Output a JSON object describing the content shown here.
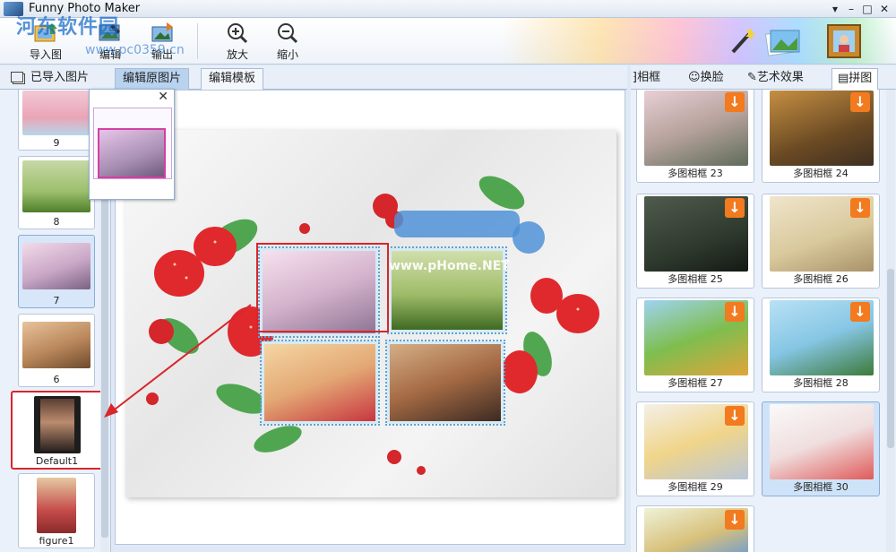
{
  "window": {
    "title": "Funny Photo Maker",
    "controls": {
      "menu": "▾",
      "minimize": "–",
      "maximize": "□",
      "close": "✕"
    }
  },
  "toolbar": {
    "import_label": "导入图片",
    "edit_label": "编辑",
    "output_label": "输出",
    "zoom_in_label": "放大",
    "zoom_out_label": "缩小"
  },
  "watermark": {
    "site": "河东软件园",
    "url": "www.pc0359.cn"
  },
  "left_tabs": {
    "imported": "已导入图片",
    "edit_original": "编辑原图片",
    "edit_template": "编辑模板"
  },
  "right_tabs": {
    "frame": "相框",
    "face_swap": "换脸",
    "art_effects": "艺术效果",
    "collage": "拼图"
  },
  "thumbnails": [
    {
      "label": "9"
    },
    {
      "label": "8"
    },
    {
      "label": "7"
    },
    {
      "label": "6"
    },
    {
      "label": "Default1"
    },
    {
      "label": "figure1"
    }
  ],
  "canvas_watermark": "www.pHome.NET",
  "templates": [
    {
      "label": "多图相框 23"
    },
    {
      "label": "多图相框 24"
    },
    {
      "label": "多图相框 25"
    },
    {
      "label": "多图相框 26"
    },
    {
      "label": "多图相框 27"
    },
    {
      "label": "多图相框 28"
    },
    {
      "label": "多图相框 29"
    },
    {
      "label": "多图相框 30"
    }
  ],
  "colors": {
    "selected_tab": "#b9d3ef",
    "highlight_red": "#d8262a",
    "download_orange": "#f27a1f"
  }
}
